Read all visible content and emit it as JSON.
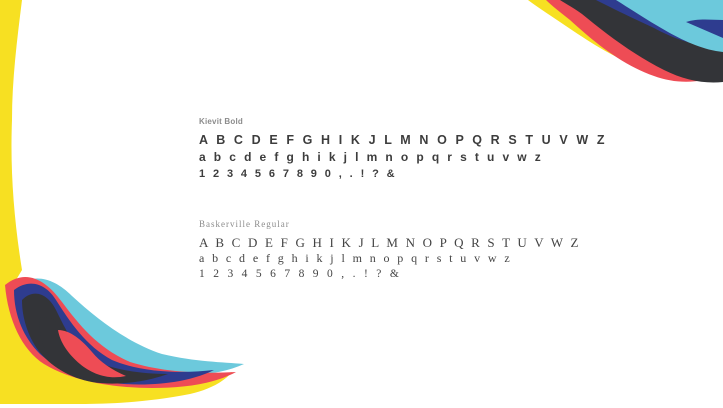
{
  "fonts": [
    {
      "name": "Kievit Bold",
      "uppercase": "A B C D E F G H I K J L M N O P Q R S T U V W Z",
      "lowercase": "a b c d e f g h i k j l m n o p q r s t u v w z",
      "digits": "1 2 3 4 5 6 7 8 9 0 , . ! ? &"
    },
    {
      "name": "Baskerville Regular",
      "uppercase": "A B C D E F G H I K J L M N O P Q R S T U V W Z",
      "lowercase": "a b c d e f g h i k j l m n o p q r s t u v w z",
      "digits": "1 2 3 4 5 6 7 8 9 0 , . ! ? &"
    }
  ],
  "colors": {
    "background": "#ffffff",
    "yellow": "#f7e022",
    "red": "#ee4c55",
    "navy": "#2e3c8f",
    "cyan": "#6cc9dc",
    "charcoal": "#333438"
  }
}
